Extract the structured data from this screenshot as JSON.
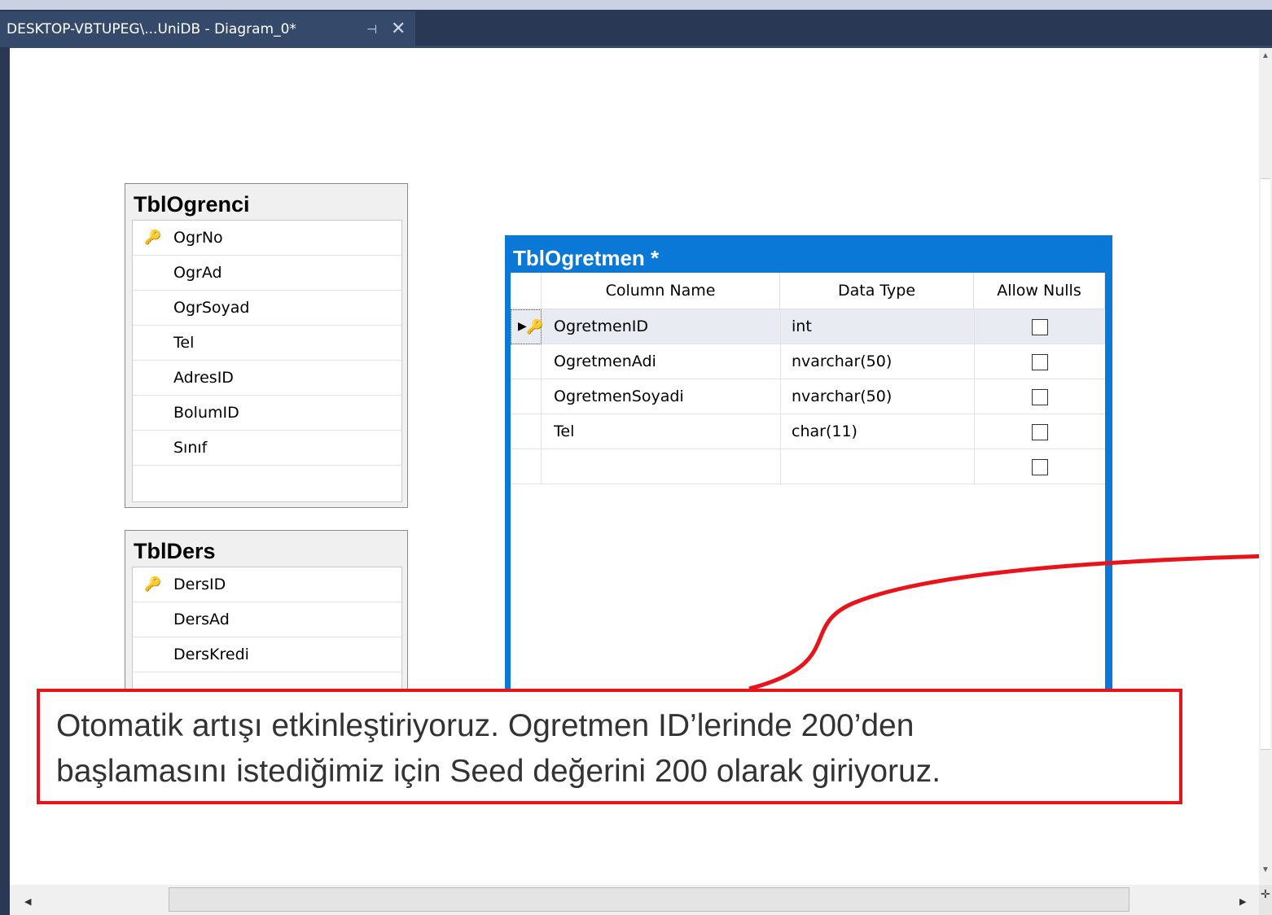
{
  "tab": {
    "title": "DESKTOP-VBTUPEG\\...UniDB - Diagram_0*",
    "pin_glyph": "⊣",
    "close_glyph": "✕"
  },
  "tables": {
    "ogrenci": {
      "title": "TblOgrenci",
      "columns": [
        "OgrNo",
        "OgrAd",
        "OgrSoyad",
        "Tel",
        "AdresID",
        "BolumID",
        "Sınıf"
      ],
      "primary_key": "OgrNo"
    },
    "ders": {
      "title": "TblDers",
      "columns": [
        "DersID",
        "DersAd",
        "DersKredi"
      ],
      "primary_key": "DersID"
    },
    "ogretmen": {
      "title": "TblOgretmen *",
      "headers": [
        "Column Name",
        "Data Type",
        "Allow Nulls"
      ],
      "rows": [
        {
          "name": "OgretmenID",
          "type": "int",
          "allow_nulls": false
        },
        {
          "name": "OgretmenAdi",
          "type": "nvarchar(50)",
          "allow_nulls": false
        },
        {
          "name": "OgretmenSoyadi",
          "type": "nvarchar(50)",
          "allow_nulls": false
        },
        {
          "name": "Tel",
          "type": "char(11)",
          "allow_nulls": false
        },
        {
          "name": "",
          "type": "",
          "allow_nulls": false
        }
      ],
      "selected_row": "OgretmenID"
    }
  },
  "callout": {
    "line1": "Otomatik artışı etkinleştiriyoruz. Ogretmen ID’lerinde 200’den",
    "line2": "başlamasını istediğimiz için Seed değerini 200 olarak giriyoruz."
  },
  "colors": {
    "accent": "#0a78d7",
    "callout_border": "#e8131b",
    "tab_bg": "#293955"
  },
  "icons": {
    "key": "primary-key-icon",
    "row_indicator": "current-row-icon"
  }
}
